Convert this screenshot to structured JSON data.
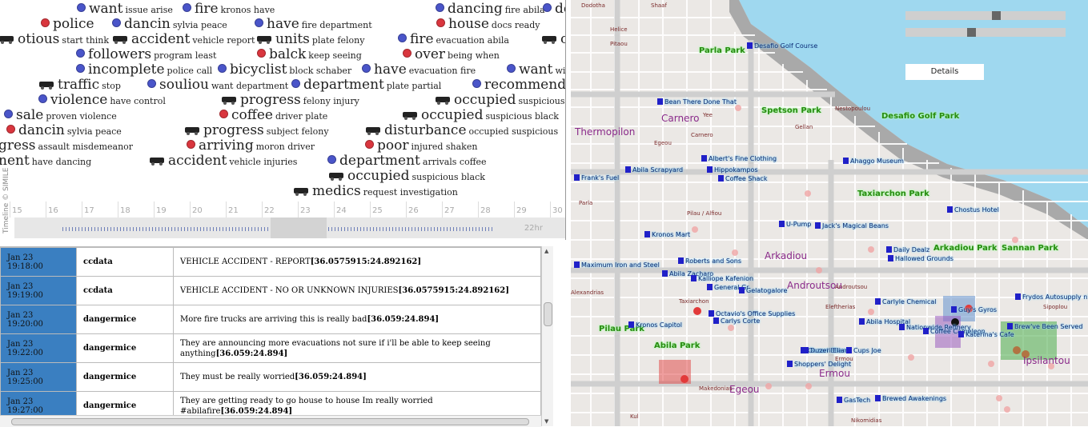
{
  "timeline": {
    "events": [
      {
        "word": "want",
        "rest": "issue arise",
        "dot": "b"
      },
      {
        "word": "fire",
        "rest": "kronos have",
        "dot": "b"
      },
      {
        "word": "dancing",
        "rest": "fire abila",
        "dot": "b"
      },
      {
        "word": "dc",
        "rest": "",
        "dot": "b"
      },
      {
        "word": "police",
        "rest": "",
        "dot": "r"
      },
      {
        "word": "dancin",
        "rest": "sylvia peace",
        "dot": "b"
      },
      {
        "word": "have",
        "rest": "fire department",
        "dot": "b"
      },
      {
        "word": "house",
        "rest": "docs ready",
        "dot": "r"
      },
      {
        "word": "otious",
        "rest": "start think",
        "dot": ""
      },
      {
        "word": "accident",
        "rest": "vehicle report",
        "dot": ""
      },
      {
        "word": "units",
        "rest": "plate felony",
        "dot": ""
      },
      {
        "word": "fire",
        "rest": "evacuation abila",
        "dot": "b"
      },
      {
        "word": "co",
        "rest": "",
        "dot": ""
      },
      {
        "word": "followers",
        "rest": "program least",
        "dot": "b"
      },
      {
        "word": "balck",
        "rest": "keep seeing",
        "dot": "r"
      },
      {
        "word": "over",
        "rest": "being when",
        "dot": "r"
      },
      {
        "word": "incomplete",
        "rest": "police call",
        "dot": "b"
      },
      {
        "word": "bicyclist",
        "rest": "block schaber",
        "dot": "b"
      },
      {
        "word": "have",
        "rest": "evacuation fire",
        "dot": "b"
      },
      {
        "word": "want",
        "rest": "wi",
        "dot": "b"
      },
      {
        "word": "traffic",
        "rest": "stop",
        "dot": ""
      },
      {
        "word": "souliou",
        "rest": "want department",
        "dot": "b"
      },
      {
        "word": "department",
        "rest": "plate partial",
        "dot": "b"
      },
      {
        "word": "recommend",
        "rest": "k",
        "dot": "b"
      },
      {
        "word": "violence",
        "rest": "have control",
        "dot": "b"
      },
      {
        "word": "progress",
        "rest": "felony injury",
        "dot": ""
      },
      {
        "word": "occupied",
        "rest": "suspicious",
        "dot": ""
      },
      {
        "word": "sale",
        "rest": "proven violence",
        "dot": "b"
      },
      {
        "word": "coffee",
        "rest": "driver plate",
        "dot": "r"
      },
      {
        "word": "occupied",
        "rest": "suspicious black",
        "dot": ""
      },
      {
        "word": "dancin",
        "rest": "sylvia peace",
        "dot": "r"
      },
      {
        "word": "progress",
        "rest": "subject felony",
        "dot": ""
      },
      {
        "word": "disturbance",
        "rest": "occupied suspicious",
        "dot": ""
      },
      {
        "word": "gress",
        "rest": "assault misdemeanor",
        "dot": ""
      },
      {
        "word": "arriving",
        "rest": "moron driver",
        "dot": "r"
      },
      {
        "word": "poor",
        "rest": "injured shaken",
        "dot": "r"
      },
      {
        "word": "nent",
        "rest": "have dancing",
        "dot": ""
      },
      {
        "word": "accident",
        "rest": "vehicle injuries",
        "dot": ""
      },
      {
        "word": "department",
        "rest": "arrivals coffee",
        "dot": "b"
      },
      {
        "word": "occupied",
        "rest": "suspicious black",
        "dot": ""
      },
      {
        "word": "medics",
        "rest": "request investigation",
        "dot": ""
      }
    ],
    "ticks": [
      "15",
      "16",
      "17",
      "18",
      "19",
      "20",
      "21",
      "22",
      "23",
      "24",
      "25",
      "26",
      "27",
      "28",
      "29",
      "30"
    ],
    "overview_label": "22hr",
    "credit": "Timeline © SIMILE"
  },
  "messages": [
    {
      "date": "Jan 23",
      "time": "19:18:00",
      "user": "ccdata",
      "text": "VEHICLE ACCIDENT - REPORT",
      "coords": "[36.0575915:24.892162]"
    },
    {
      "date": "Jan 23",
      "time": "19:19:00",
      "user": "ccdata",
      "text": "VEHICLE ACCIDENT - NO OR UNKNOWN INJURIES",
      "coords": "[36.0575915:24.892162]"
    },
    {
      "date": "Jan 23",
      "time": "19:20:00",
      "user": "dangermice",
      "text": "More fire trucks are arriving this is really bad",
      "coords": "[36.059:24.894]"
    },
    {
      "date": "Jan 23",
      "time": "19:22:00",
      "user": "dangermice",
      "text": "They are announcing more evacuations not sure if i'll be able to keep seeing anything",
      "coords": "[36.059:24.894]"
    },
    {
      "date": "Jan 23",
      "time": "19:25:00",
      "user": "dangermice",
      "text": "They must be really worried",
      "coords": "[36.059:24.894]"
    },
    {
      "date": "Jan 23",
      "time": "19:27:00",
      "user": "dangermice",
      "text": "They are getting ready to go house to house Im really worried #abilafire",
      "coords": "[36.059:24.894]"
    }
  ],
  "map": {
    "details_label": "Details",
    "slider1_fraction": 0.57,
    "slider2_fraction": 0.41,
    "parks": [
      "Parla Park",
      "Spetson Park",
      "Desafio Golf Park",
      "Taxiarchon Park",
      "Arkadiou Park",
      "Sannan Park",
      "Pilau Park",
      "Abila Park"
    ],
    "districts": [
      "Carnero",
      "Thermopilon",
      "Arkadiou",
      "Androutsou",
      "Ermou",
      "Egeou",
      "Ipsilantou"
    ],
    "landmarks": [
      "Desafio Golf Course",
      "Bean There Done That",
      "Albert's Fine Clothing",
      "Hippokampos",
      "Coffee Shack",
      "Frank's Fuel",
      "Abila Scrapyard",
      "Kronos Mart",
      "U-Pump",
      "Jack's Magical Beans",
      "Ahaggo Museum",
      "Chostus Hotel",
      "Maximum Iron and Steel",
      "Roberts and Sons",
      "Abila Zacharo",
      "General Gr",
      "Ouzeri Elian",
      "Guy's Gyros",
      "Carlyle Chemical",
      "Octavio's Office Supplies",
      "Carlys Corte",
      "Kronos Capitol",
      "Abila Hospital",
      "Nationwide Refinery",
      "Coffee Cameleon",
      "Katerina's Cafe",
      "Brew've Been Served",
      "Frydos Autosupply n'",
      "Daily Dealz",
      "Hallowed Grounds",
      "Duzeri Elian",
      "Cups Joe",
      "Shoppers' Delight",
      "GasTech",
      "Brewed Awakenings",
      "Gelatogalore",
      "Kalliope Kafenion"
    ],
    "streets": [
      "Dodotha",
      "Shaaf",
      "Helice",
      "Pitaou",
      "Parla",
      "Pilau / Alfiou",
      "Alexandrias",
      "Taxiarchon",
      "Eleftherias",
      "Makedonias",
      "Nikomidias",
      "Carnero",
      "Egeou",
      "Kul",
      "Gellan",
      "Nestopoulou",
      "Yee",
      "Androutsou",
      "Ermou",
      "Sipoplou"
    ]
  }
}
